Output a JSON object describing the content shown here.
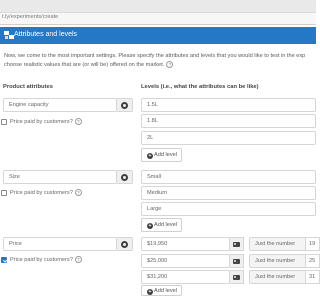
{
  "browser": {
    "url": "t.ly/experiments/create"
  },
  "panel": {
    "title": "Attributes and levels"
  },
  "intro": {
    "line1": "Now, we come to the most important settings. Please specify the attributes and levels that you would like to test in the exp",
    "line2": "choose realistic values that are (or will be) offered on the market.",
    "help_glyph": "?"
  },
  "columns": {
    "attributes": "Product attributes",
    "levels": "Levels (i.e., what the attributes can be like)"
  },
  "attributes": [
    {
      "name": "Engine capacity",
      "price_label": "Price paid by customers?",
      "price_checked": false,
      "levels": [
        "1.5L",
        "1.8L",
        "2L"
      ],
      "add_label": "Add level"
    },
    {
      "name": "Size",
      "price_label": "Price paid by customers?",
      "price_checked": false,
      "levels": [
        "Small",
        "Medium",
        "Large"
      ],
      "add_label": "Add level"
    },
    {
      "name": "Price",
      "price_label": "Price paid by customers?",
      "price_checked": true,
      "levels": [
        {
          "value": "$19,950",
          "mode": "Just the number",
          "number": "19"
        },
        {
          "value": "$25,000",
          "mode": "Just the number",
          "number": "25"
        },
        {
          "value": "$31,200",
          "mode": "Just the number",
          "number": "31"
        }
      ],
      "add_label": "Add level"
    }
  ],
  "icons": {
    "header": "attributes-icon",
    "settings": "gear-icon",
    "help": "help-circle-icon",
    "image": "image-icon",
    "add": "plus-circle-icon",
    "checkbox": "checkbox-icon"
  },
  "colors": {
    "accent": "#2478c6",
    "header_text": "#ffffff"
  }
}
